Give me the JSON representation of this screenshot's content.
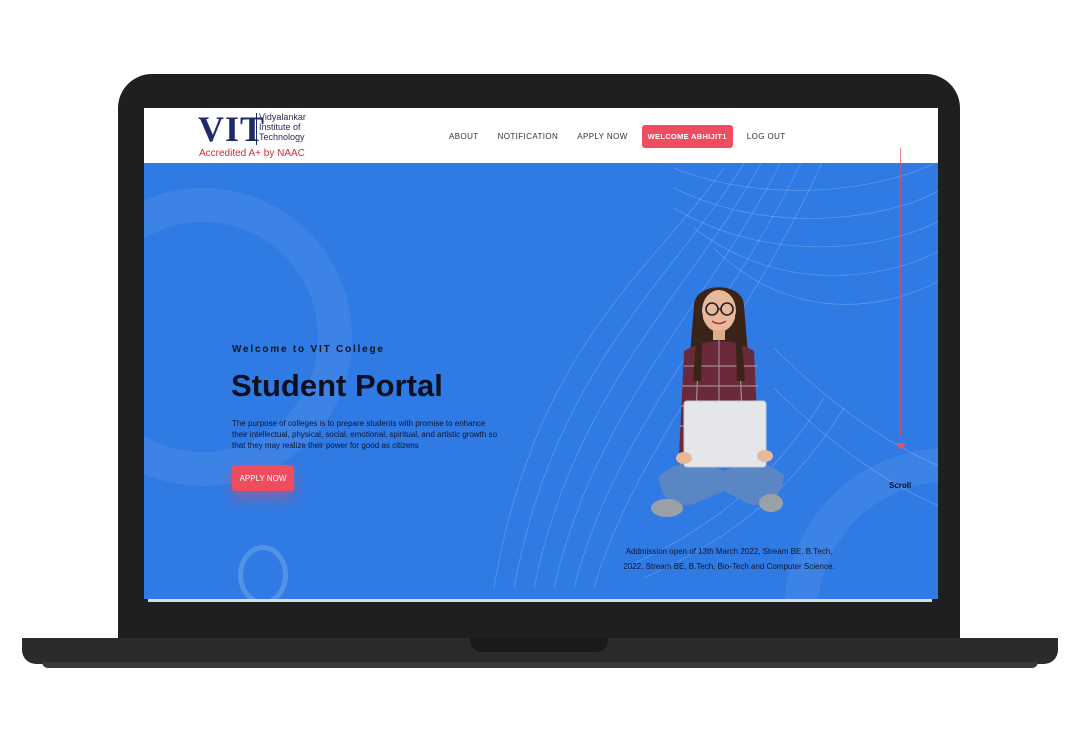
{
  "logo": {
    "brand": "VIT",
    "name_lines": [
      "Vidyalankar",
      "Institute of",
      "Technology"
    ],
    "accreditation": "Accredited A+ by NAAC"
  },
  "nav": {
    "items": [
      "ABOUT",
      "NOTIFICATION",
      "APPLY NOW"
    ],
    "welcome": "WELCOME ABHIJIT1",
    "logout": "LOG OUT"
  },
  "hero": {
    "kicker": "Welcome to VIT College",
    "title": "Student Portal",
    "description": "The purpose of colleges is to prepare students with promise to enhance their intellectual, physical, social, emotional, spiritual, and artistic growth so that they may realize their power for good as citizens",
    "apply_button": "APPLY NOW"
  },
  "scroll": {
    "label": "Scroll"
  },
  "notice": {
    "line1": "Addmission open of 13th March 2022, Stream BE, B.Tech,",
    "line2": "2022, Stream BE, B.Tech, Bio-Tech and Computer Science."
  },
  "colors": {
    "hero_bg": "#2f7ae3",
    "accent": "#ee4c5f",
    "laptop": "#1d1f21"
  }
}
